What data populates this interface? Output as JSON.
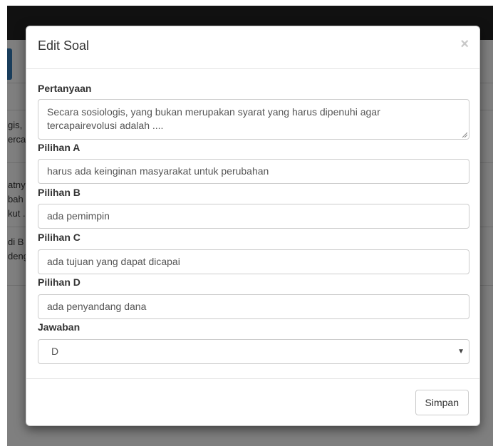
{
  "background": {
    "snippets": [
      {
        "id": "s1",
        "text": "gis,"
      },
      {
        "id": "s2",
        "text": "erca"
      },
      {
        "id": "s3",
        "text": "atny"
      },
      {
        "id": "s4",
        "text": "bah"
      },
      {
        "id": "s5",
        "text": "kut ."
      },
      {
        "id": "s6",
        "text": "di B"
      },
      {
        "id": "s7",
        "text": "deng"
      }
    ]
  },
  "modal": {
    "title": "Edit Soal",
    "close_icon": "×",
    "question_label": "Pertanyaan",
    "question_value_line1": "Secara sosiologis, yang bukan merupakan syarat yang harus dipenuhi agar",
    "question_value_line2": "tercapairevolusi adalah ....",
    "option_a_label": "Pilihan A",
    "option_a_value": "harus ada keinginan masyarakat untuk perubahan",
    "option_b_label": "Pilihan B",
    "option_b_value": "ada pemimpin",
    "option_c_label": "Pilihan C",
    "option_c_value": "ada tujuan yang dapat dicapai",
    "option_d_label": "Pilihan D",
    "option_d_value": "ada penyandang dana",
    "answer_label": "Jawaban",
    "answer_value": "D",
    "select_arrow_icon": "▼",
    "save_label": "Simpan"
  },
  "colors": {
    "overlay": "rgba(0,0,0,0.5)",
    "topbar": "#222222",
    "primary": "#337ab7"
  }
}
